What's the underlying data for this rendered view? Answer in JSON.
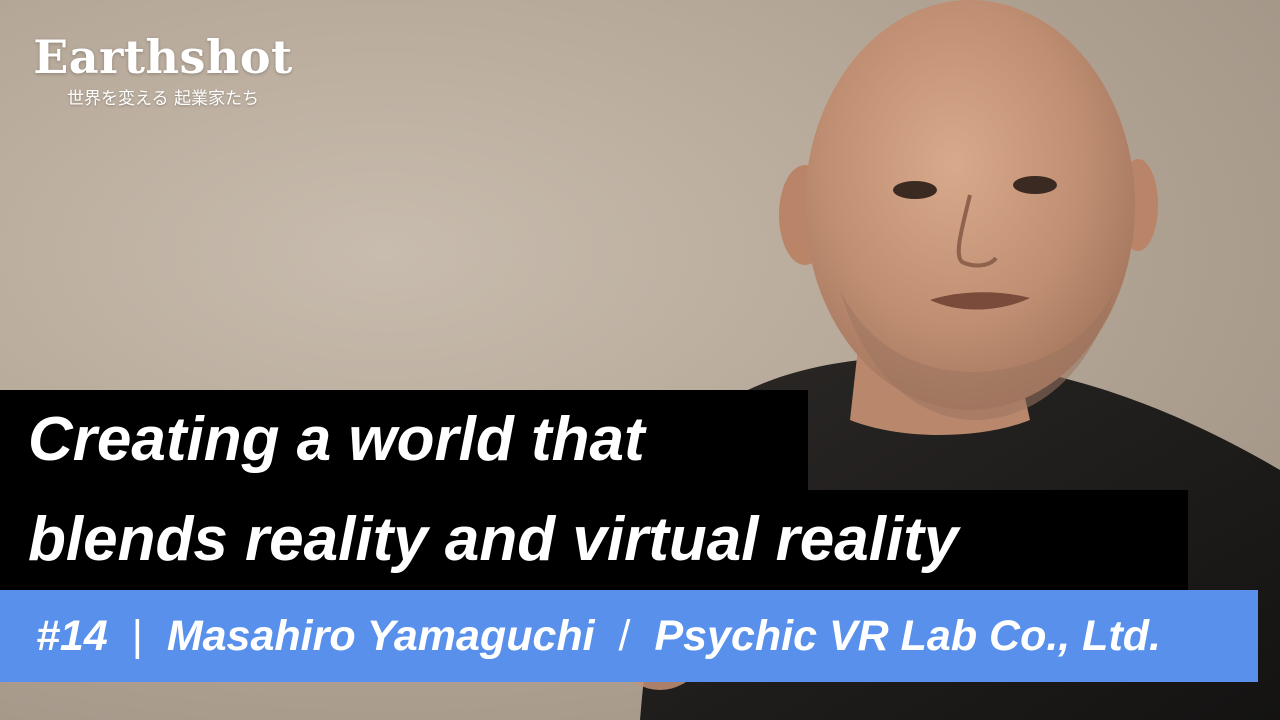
{
  "brand": {
    "name": "Earthshot",
    "tagline": "世界を変える 起業家たち"
  },
  "headline": {
    "line1": "Creating a world that",
    "line2": "blends reality and virtual reality"
  },
  "episode": {
    "number": "#14",
    "separator1": "|",
    "person": "Masahiro Yamaguchi",
    "separator2": "/",
    "company": "Psychic VR Lab Co., Ltd."
  },
  "colors": {
    "headline_background": "#000000",
    "episode_background": "#5890ec",
    "text": "#ffffff"
  }
}
